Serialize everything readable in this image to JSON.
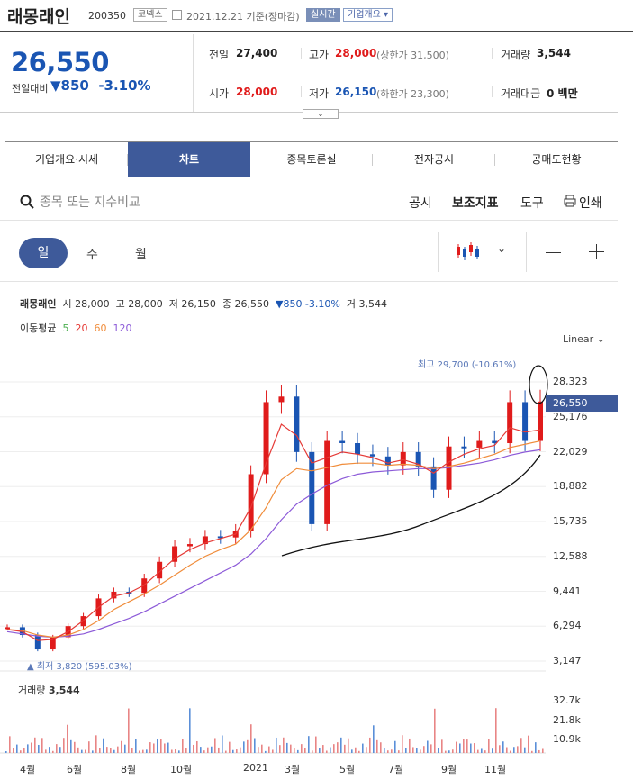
{
  "header": {
    "name": "래몽래인",
    "code": "200350",
    "market": "코넥스",
    "date": "2021.12.21",
    "basis": "기준(장마감)",
    "realtime": "실시간",
    "overview": "기업개요"
  },
  "quote": {
    "price": "26,550",
    "change_label": "전일대비",
    "change": "850",
    "change_pct": "-3.10%"
  },
  "stats": {
    "prev_label": "전일",
    "prev": "27,400",
    "high_label": "고가",
    "high": "28,000",
    "high_limit": "(상한가 31,500)",
    "vol_label": "거래량",
    "vol": "3,544",
    "open_label": "시가",
    "open": "28,000",
    "low_label": "저가",
    "low": "26,150",
    "low_limit": "(하한가 23,300)",
    "amt_label": "거래대금",
    "amt": "0 백만"
  },
  "tabs": [
    "기업개요·시세",
    "차트",
    "종목토론실",
    "전자공시",
    "공매도현황"
  ],
  "toolbar": {
    "search_placeholder": "종목 또는 지수비교",
    "disclosure": "공시",
    "indicator": "보조지표",
    "tools": "도구",
    "print": "인쇄"
  },
  "periods": [
    "일",
    "주",
    "월"
  ],
  "info": {
    "name": "래몽래인",
    "o_label": "시",
    "o": "28,000",
    "h_label": "고",
    "h": "28,000",
    "l_label": "저",
    "l": "26,150",
    "c_label": "종",
    "c": "26,550",
    "chg": "▼850 -3.10%",
    "v_label": "거",
    "v": "3,544"
  },
  "ma": {
    "label": "이동평균",
    "p5": "5",
    "p20": "20",
    "p60": "60",
    "p120": "120"
  },
  "scale": "Linear",
  "chart_data": {
    "type": "line",
    "title": "",
    "y_ticks": [
      "28,323",
      "25,176",
      "22,029",
      "18,882",
      "15,735",
      "12,588",
      "9,441",
      "6,294",
      "3,147"
    ],
    "x_ticks": [
      "4월",
      "6월",
      "8월",
      "10월",
      "2021",
      "3월",
      "5월",
      "7월",
      "9월",
      "11월"
    ],
    "current_price": "26,550",
    "max_annotation": "최고 29,700 (-10.61%)",
    "min_annotation": "최저 3,820 (595.03%)",
    "volume_label": "거래량",
    "volume": "3,544",
    "volume_ticks": [
      "32.7k",
      "21.8k",
      "10.9k"
    ],
    "ylim": [
      3147,
      31000
    ],
    "close": [
      6200,
      5500,
      4200,
      5300,
      6300,
      7200,
      8800,
      9400,
      9300,
      10600,
      12100,
      13500,
      13700,
      14400,
      14300,
      14900,
      20000,
      26500,
      27000,
      22000,
      15500,
      23000,
      22800,
      21800,
      21600,
      20800,
      22000,
      20700,
      18600,
      22500,
      22400,
      23000,
      22800,
      26500,
      23000,
      26550
    ],
    "ma20": [
      6000,
      5800,
      5000,
      5100,
      5800,
      6800,
      8000,
      9000,
      9300,
      10000,
      11200,
      12400,
      13200,
      13800,
      14200,
      14600,
      17000,
      21000,
      24500,
      23500,
      21000,
      21500,
      22000,
      21800,
      21500,
      21000,
      21300,
      20900,
      20100,
      21100,
      21800,
      22300,
      22600,
      24200,
      23800,
      24000
    ],
    "ma60": [
      6000,
      5900,
      5500,
      5300,
      5500,
      6000,
      6800,
      7800,
      8500,
      9200,
      10000,
      10900,
      11800,
      12600,
      13200,
      13700,
      15000,
      17000,
      19500,
      20500,
      20300,
      20600,
      20900,
      21000,
      21000,
      20800,
      20900,
      20800,
      20500,
      20700,
      21000,
      21400,
      21800,
      22400,
      22700,
      23000
    ],
    "ma120": [
      5800,
      5600,
      5400,
      5300,
      5400,
      5600,
      6000,
      6500,
      7000,
      7600,
      8300,
      9000,
      9700,
      10400,
      11100,
      11800,
      12800,
      14200,
      15900,
      17300,
      18200,
      19000,
      19600,
      20000,
      20200,
      20300,
      20400,
      20500,
      20500,
      20600,
      20800,
      21000,
      21300,
      21700,
      22000,
      22200
    ]
  }
}
